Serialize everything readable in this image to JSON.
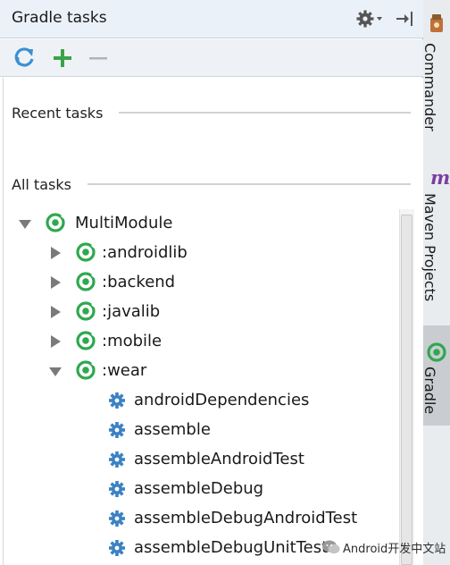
{
  "panel": {
    "title": "Gradle tasks",
    "icons": [
      "gear-icon",
      "hide-panel-icon",
      "refresh-icon",
      "add-icon",
      "remove-icon"
    ]
  },
  "sections": {
    "recent": "Recent tasks",
    "all": "All tasks"
  },
  "tree": {
    "root": {
      "label": "MultiModule",
      "expanded": true
    },
    "modules": [
      {
        "label": ":androidlib",
        "expanded": false
      },
      {
        "label": ":backend",
        "expanded": false
      },
      {
        "label": ":javalib",
        "expanded": false
      },
      {
        "label": ":mobile",
        "expanded": false
      },
      {
        "label": ":wear",
        "expanded": true
      }
    ],
    "tasks": [
      "androidDependencies",
      "assemble",
      "assembleAndroidTest",
      "assembleDebug",
      "assembleDebugAndroidTest",
      "assembleDebugUnitTest"
    ]
  },
  "side_tabs": {
    "commander": "Commander",
    "maven": "Maven Projects",
    "maven_icon": "m",
    "gradle": "Gradle"
  },
  "watermark": "Android开发中文站",
  "colors": {
    "gradle_green": "#2fa84f",
    "gear_blue": "#3b82c4",
    "refresh_blue": "#3d8fd1",
    "add_green": "#3aa34a",
    "maven_purple": "#7b3fa0"
  }
}
